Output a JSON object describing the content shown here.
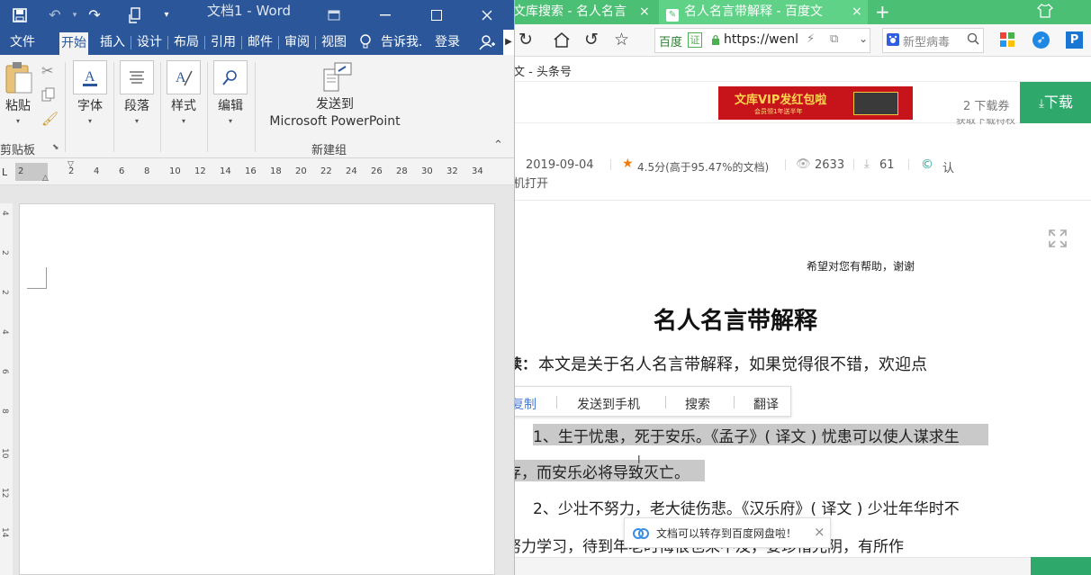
{
  "word": {
    "title": "文档1 - Word",
    "tabs": [
      "文件",
      "开始",
      "插入",
      "设计",
      "布局",
      "引用",
      "邮件",
      "审阅",
      "视图"
    ],
    "tell_me": "告诉我.",
    "login": "登录",
    "ribbon": {
      "paste": "粘贴",
      "clipboard_group": "剪贴板",
      "font": "字体",
      "paragraph": "段落",
      "styles": "样式",
      "editing": "编辑",
      "send_line1": "发送到",
      "send_line2": "Microsoft PowerPoint",
      "new_group": "新建组"
    },
    "ruler_labels": [
      "2",
      "2",
      "4",
      "6",
      "8",
      "10",
      "12",
      "14",
      "16",
      "18",
      "20",
      "22",
      "24",
      "26",
      "28",
      "30",
      "32",
      "34"
    ],
    "vruler_labels": [
      "4",
      "2",
      "2",
      "4",
      "6",
      "8",
      "10",
      "12",
      "14"
    ]
  },
  "browser": {
    "tabs": [
      {
        "label": "文库搜索 - 名人名言"
      },
      {
        "label": "名人名言带解释 - 百度文"
      }
    ],
    "new_tab": "+",
    "url_prefix": "百度",
    "url_badge": "证",
    "url_text": "https://wenl",
    "search_text": "新型病毒",
    "bookmark_text": "文 - 头条号",
    "download_coupons": "2 下载券",
    "download_button": "下载",
    "vip_banner": "文库VIP发红包啦",
    "vip_banner_sub": "会员领1年送半年",
    "gift_hint": "获取下载特权",
    "meta": {
      "date": "2019-09-04",
      "rating": "4.5分(高于95.47%的文档)",
      "views": "2633",
      "downloads": "61",
      "cert": "认",
      "open_phone": "机打开"
    },
    "doc": {
      "helpful": "希望对您有帮助，谢谢",
      "title": "名人名言带解释",
      "intro_label": "读：",
      "intro": "本文是关于名人名言带解释，如果觉得很不错，欢迎点",
      "context_menu": [
        "复制",
        "发送到手机",
        "搜索",
        "翻译"
      ],
      "line1": "1、生于忧患，死于安乐。《孟子》( 译文 ) 忧患可以使人谋求生",
      "line2": "存，而安乐必将导致灭亡。",
      "line3": "2、少壮不努力，老大徒伤悲。《汉乐府》( 译文 ) 少壮年华时不",
      "line4": "努力学习，待到年老时悔恨也来不及，要珍惜光阴，有所作",
      "toast": "文档可以转存到百度网盘啦！"
    }
  }
}
